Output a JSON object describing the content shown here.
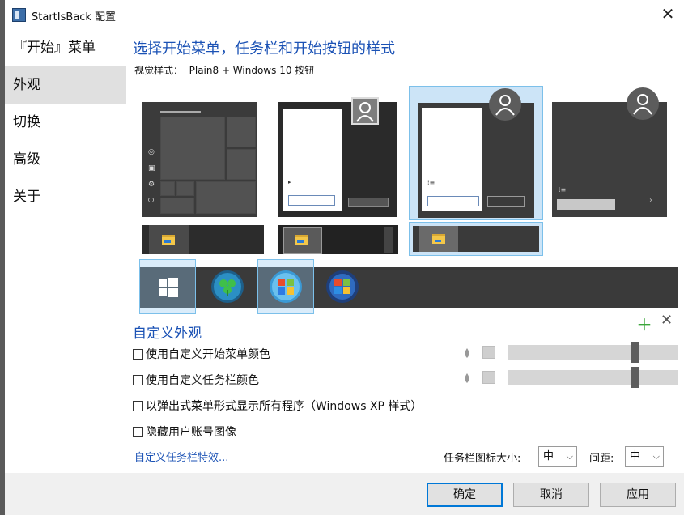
{
  "window": {
    "title": "StartIsBack 配置"
  },
  "sidebar": {
    "items": [
      {
        "label": "『开始』菜单"
      },
      {
        "label": "外观"
      },
      {
        "label": "切换"
      },
      {
        "label": "高级"
      },
      {
        "label": "关于"
      }
    ],
    "selected_index": 1
  },
  "main": {
    "heading": "选择开始菜单，任务栏和开始按钮的样式",
    "visual_style": "视觉样式：  Plain8 + Windows 10 按钮",
    "styles": {
      "count": 4,
      "selected_index": 2
    },
    "orbs": {
      "count": 4,
      "selected_index": 2
    }
  },
  "custom": {
    "title": "自定义外观",
    "options": [
      {
        "label": "使用自定义开始菜单颜色",
        "checked": false,
        "slider": 0.76
      },
      {
        "label": "使用自定义任务栏颜色",
        "checked": false,
        "slider": 0.76
      },
      {
        "label": "以弹出式菜单形式显示所有程序（Windows XP 样式）",
        "checked": false
      },
      {
        "label": "隐藏用户账号图像",
        "checked": false
      }
    ],
    "link": "自定义任务栏特效...",
    "icon_size_label": "任务栏图标大小:",
    "icon_size_value": "中",
    "spacing_label": "间距:",
    "spacing_value": "中"
  },
  "footer": {
    "ok": "确定",
    "cancel": "取消",
    "apply": "应用"
  },
  "colors": {
    "accent": "#1b52b5",
    "selection": "#cce4f7",
    "selection_border": "#7cc0ea",
    "primary_border": "#0078d7"
  },
  "icons": [
    "app-icon",
    "close-icon",
    "user-avatar-icon",
    "folder-icon",
    "windows-logo-icon",
    "clover-orb-icon",
    "windows7-orb-icon",
    "plus-icon",
    "remove-icon",
    "droplet-icon",
    "chevron-down-icon"
  ]
}
